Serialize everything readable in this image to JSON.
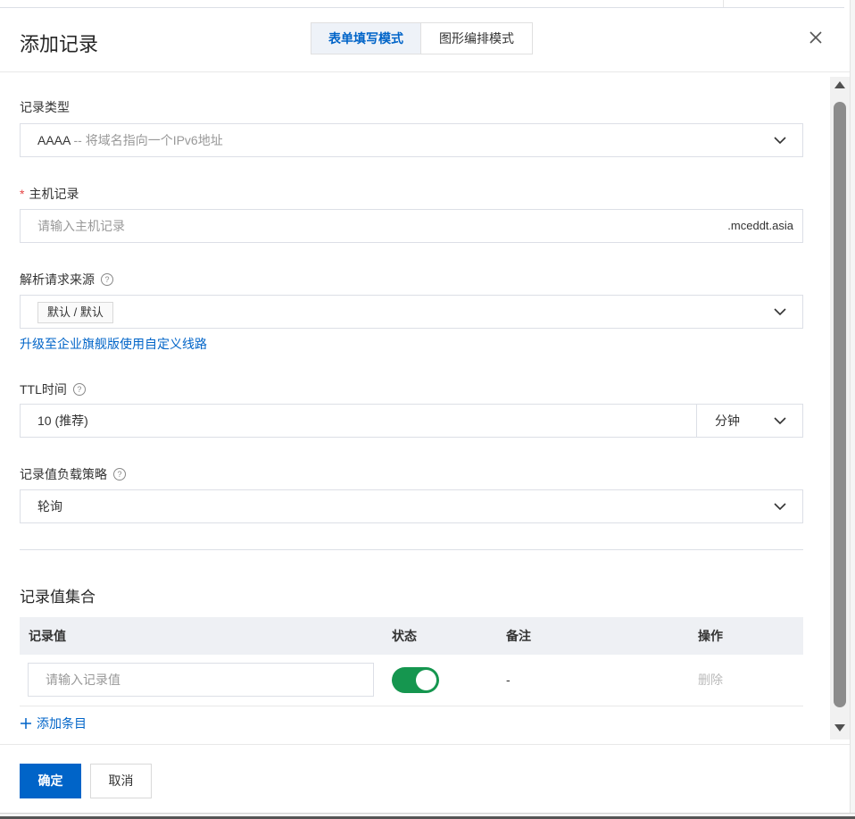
{
  "dialog": {
    "title": "添加记录",
    "close_icon": "close-icon"
  },
  "mode_tabs": [
    {
      "label": "表单填写模式",
      "active": true
    },
    {
      "label": "图形编排模式",
      "active": false
    }
  ],
  "record_type": {
    "label": "记录类型",
    "value": "AAAA",
    "description": "-- 将域名指向一个IPv6地址"
  },
  "host_record": {
    "required_mark": "*",
    "label": "主机记录",
    "placeholder": "请输入主机记录",
    "suffix": ".mceddt.asia"
  },
  "resolution_source": {
    "label": "解析请求来源",
    "help_icon": "help-icon",
    "value_tag": "默认 / 默认"
  },
  "upgrade_link": "升级至企业旗舰版使用自定义线路",
  "ttl": {
    "label": "TTL时间",
    "value": "10 (推荐)",
    "unit": "分钟"
  },
  "load_strategy": {
    "label": "记录值负载策略",
    "value": "轮询"
  },
  "record_set": {
    "title": "记录值集合",
    "columns": [
      "记录值",
      "状态",
      "备注",
      "操作"
    ],
    "rows": [
      {
        "value_placeholder": "请输入记录值",
        "status_enabled": true,
        "remark": "-",
        "action": "删除"
      }
    ],
    "add_label": "添加条目"
  },
  "footer": {
    "confirm": "确定",
    "cancel": "取消"
  },
  "colors": {
    "accent": "#0064c8",
    "toggle_on": "#15964f",
    "required": "#e54545"
  }
}
